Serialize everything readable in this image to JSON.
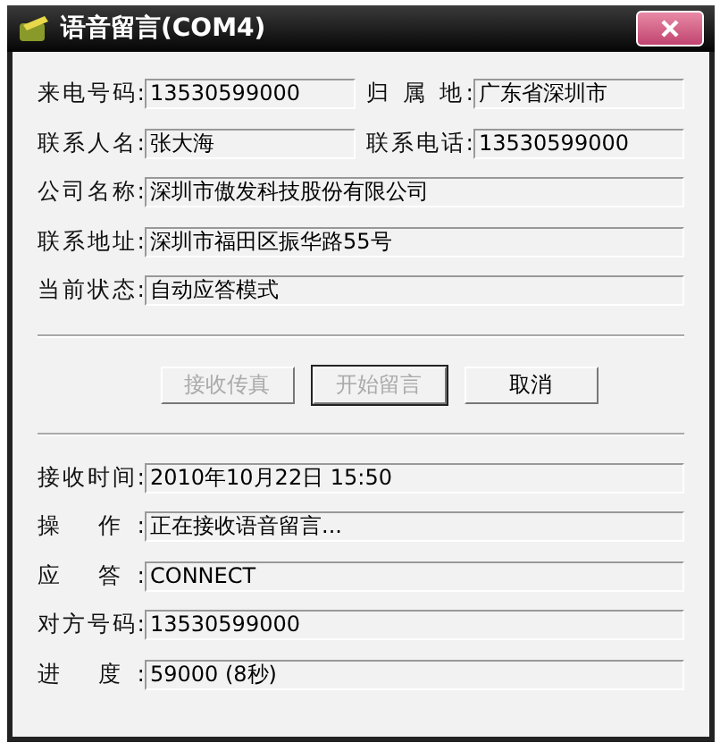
{
  "window": {
    "title": "语音留言(COM4)"
  },
  "caller_rows": [
    {
      "fields": [
        {
          "label": "来电号码:",
          "value": "13530599000"
        },
        {
          "label": "归 属 地:",
          "value": "广东省深圳市"
        }
      ]
    },
    {
      "fields": [
        {
          "label": "联系人名:",
          "value": "张大海"
        },
        {
          "label": "联系电话:",
          "value": "13530599000"
        }
      ]
    },
    {
      "fields": [
        {
          "label": "公司名称:",
          "value": "深圳市傲发科技股份有限公司"
        }
      ]
    },
    {
      "fields": [
        {
          "label": "联系地址:",
          "value": "深圳市福田区振华路55号"
        }
      ]
    },
    {
      "fields": [
        {
          "label": "当前状态:",
          "value": "自动应答模式"
        }
      ]
    }
  ],
  "buttons": [
    {
      "label": "接收传真",
      "disabled": true,
      "focused": false
    },
    {
      "label": "开始留言",
      "disabled": true,
      "focused": true
    },
    {
      "label": "取消",
      "disabled": false,
      "focused": false
    }
  ],
  "status_rows": [
    {
      "label": "接收时间:",
      "value": "2010年10月22日 15:50"
    },
    {
      "label": "操 作:",
      "value": "正在接收语音留言..."
    },
    {
      "label": "应 答:",
      "value": "CONNECT"
    },
    {
      "label": "对方号码:",
      "value": "13530599000"
    },
    {
      "label": "进 度:",
      "value": "59000 (8秒)"
    }
  ]
}
